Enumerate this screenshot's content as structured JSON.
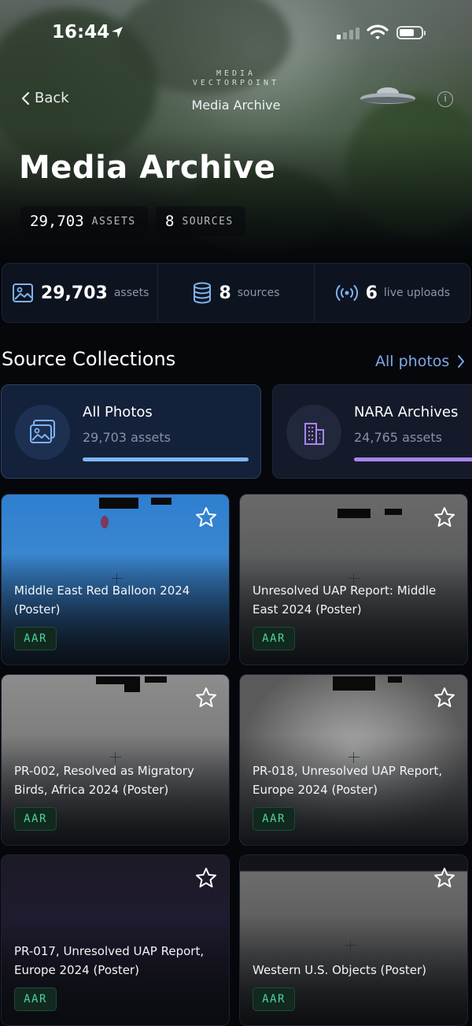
{
  "status_bar": {
    "time": "16:44"
  },
  "nav": {
    "back_label": "Back",
    "brand_line1": "MEDIA",
    "brand_line2": "VECTORPOINT",
    "title": "Media Archive"
  },
  "hero": {
    "title": "Media Archive",
    "chips": [
      {
        "value": "29,703",
        "label": "ASSETS"
      },
      {
        "value": "8",
        "label": "SOURCES"
      }
    ]
  },
  "stats": [
    {
      "icon": "image-icon",
      "value": "29,703",
      "label": "assets"
    },
    {
      "icon": "database-icon",
      "value": "8",
      "label": "sources"
    },
    {
      "icon": "broadcast-icon",
      "value": "6",
      "label": "live uploads"
    }
  ],
  "section": {
    "title": "Source Collections",
    "link_label": "All photos"
  },
  "collections": [
    {
      "title": "All Photos",
      "subtitle": "29,703 assets",
      "icon": "photo-gallery-icon",
      "accent": "#7eb6f7"
    },
    {
      "title": "NARA Archives",
      "subtitle": "24,765 assets",
      "icon": "building-icon",
      "accent": "#a985ee"
    }
  ],
  "cards": [
    {
      "title": "Middle East Red Balloon 2024 (Poster)",
      "badge": "AAR"
    },
    {
      "title": "Unresolved UAP Report: Middle East 2024 (Poster)",
      "badge": "AAR"
    },
    {
      "title": "PR-002, Resolved as Migratory Birds, Africa 2024 (Poster)",
      "badge": "AAR"
    },
    {
      "title": "PR-018, Unresolved UAP Report, Europe 2024 (Poster)",
      "badge": "AAR"
    },
    {
      "title": "PR-017, Unresolved UAP Report, Europe 2024 (Poster)",
      "badge": "AAR"
    },
    {
      "title": "Western U.S. Objects (Poster)",
      "badge": "AAR"
    }
  ]
}
